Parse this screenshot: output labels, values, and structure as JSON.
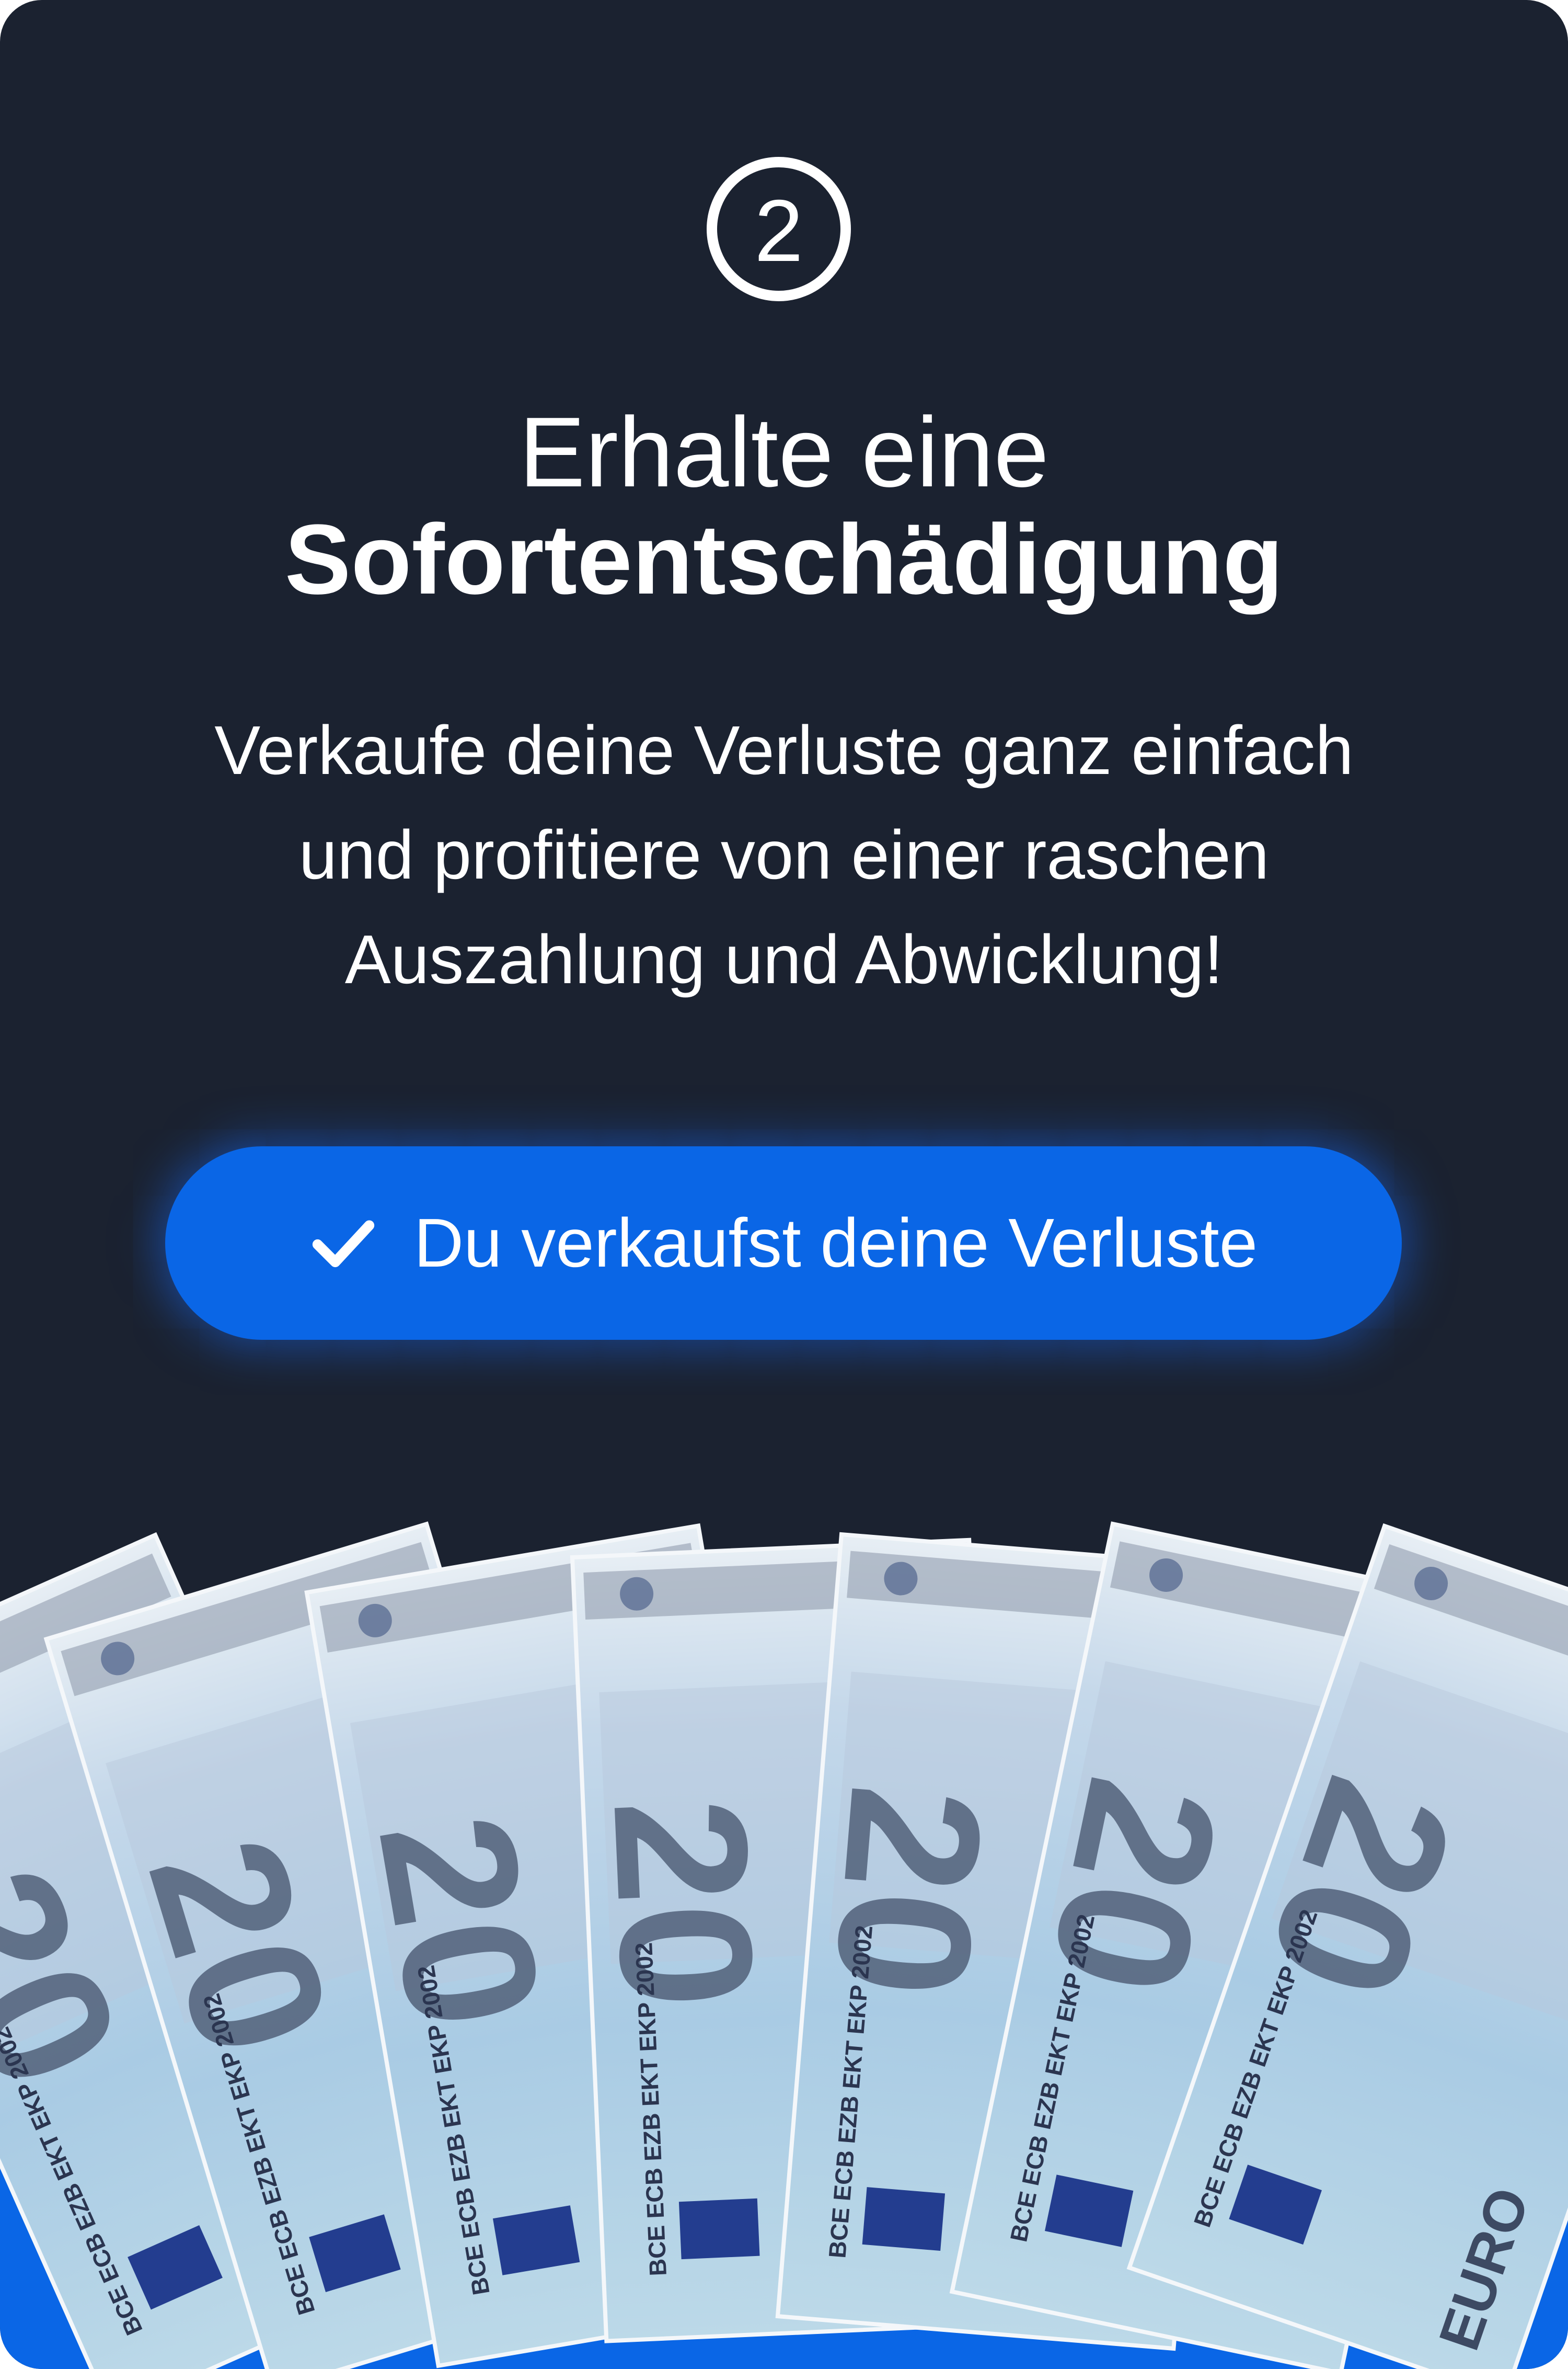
{
  "step": {
    "number": "2",
    "icon": "step-number-circle-icon"
  },
  "title": {
    "line1": "Erhalte eine",
    "line2": "Sofortentschädigung"
  },
  "description": {
    "lines": [
      "Verkaufe deine Verluste ganz einfach",
      "und profitiere von einer raschen",
      "Auszahlung und Abwicklung!"
    ]
  },
  "cta": {
    "label": "Du verkaufst deine Verluste",
    "icon": "checkmark-icon"
  },
  "illustration": {
    "banknote_value": "20",
    "banknote_currency": "EURO",
    "banknote_print": "BCE ECB EZB EKT EKP",
    "banknote_year": "2002",
    "count": 7
  },
  "colors": {
    "background": "#1b2230",
    "accent": "#0a66e6",
    "text": "#ffffff",
    "banknote": "#9fc4e6"
  }
}
